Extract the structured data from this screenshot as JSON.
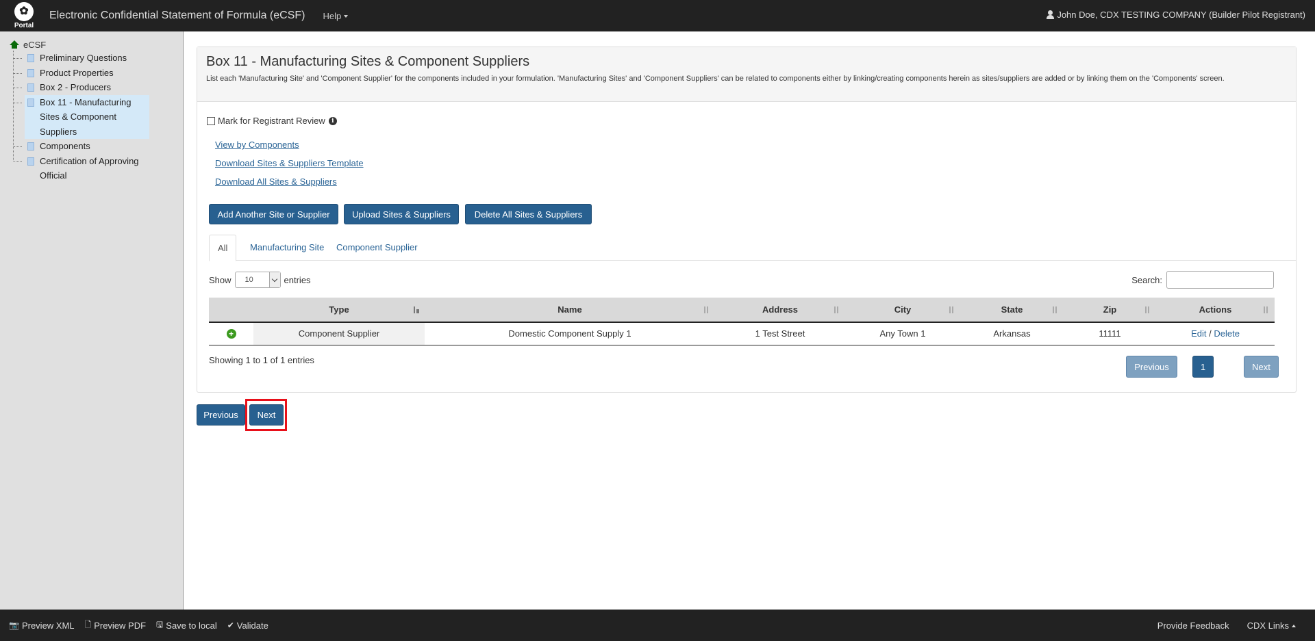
{
  "header": {
    "logo_text": "Portal",
    "app_title": "Electronic Confidential Statement of Formula (eCSF)",
    "help_label": "Help",
    "user_label": "John Doe, CDX TESTING COMPANY (Builder Pilot Registrant)"
  },
  "sidebar": {
    "root": "eCSF",
    "items": [
      {
        "label": "Preliminary Questions"
      },
      {
        "label": "Product Properties"
      },
      {
        "label": "Box 2 - Producers"
      },
      {
        "label": "Box 11 - Manufacturing Sites & Component Suppliers"
      },
      {
        "label": "Components"
      },
      {
        "label": "Certification of Approving Official"
      }
    ]
  },
  "panel": {
    "title": "Box 11 - Manufacturing Sites & Component Suppliers",
    "description": "List each 'Manufacturing Site' and 'Component Supplier' for the components included in your formulation. 'Manufacturing Sites' and 'Component Suppliers' can be related to components either by linking/creating components herein as sites/suppliers are added or by linking them on the 'Components' screen.",
    "review_label": "Mark for Registrant Review",
    "links": {
      "view_by_components": "View by Components",
      "download_template": "Download Sites & Suppliers Template",
      "download_all": "Download All Sites & Suppliers"
    },
    "buttons": {
      "add": "Add Another Site or Supplier",
      "upload": "Upload Sites & Suppliers",
      "delete_all": "Delete All Sites & Suppliers"
    },
    "tabs": [
      "All",
      "Manufacturing Site",
      "Component Supplier"
    ],
    "show_label": "Show",
    "entries_value": "10",
    "entries_label": "entries",
    "search_label": "Search:",
    "table": {
      "columns": [
        "Type",
        "Name",
        "Address",
        "City",
        "State",
        "Zip",
        "Actions"
      ],
      "rows": [
        {
          "type": "Component Supplier",
          "name": "Domestic Component Supply 1",
          "address": "1 Test Street",
          "city": "Any Town 1",
          "state": "Arkansas",
          "zip": "11111",
          "edit": "Edit",
          "sep": "/",
          "delete": "Delete"
        }
      ]
    },
    "showing_text": "Showing 1 to 1 of 1 entries",
    "pagination": {
      "previous": "Previous",
      "current": "1",
      "next": "Next"
    }
  },
  "nav": {
    "previous": "Previous",
    "next": "Next"
  },
  "footer": {
    "preview_xml": "Preview XML",
    "preview_pdf": "Preview PDF",
    "save_local": "Save to local",
    "validate": "Validate",
    "feedback": "Provide Feedback",
    "cdx_links": "CDX Links"
  },
  "colors": {
    "primary": "#286090",
    "highlight": "#e8101a",
    "bar": "#222222"
  }
}
